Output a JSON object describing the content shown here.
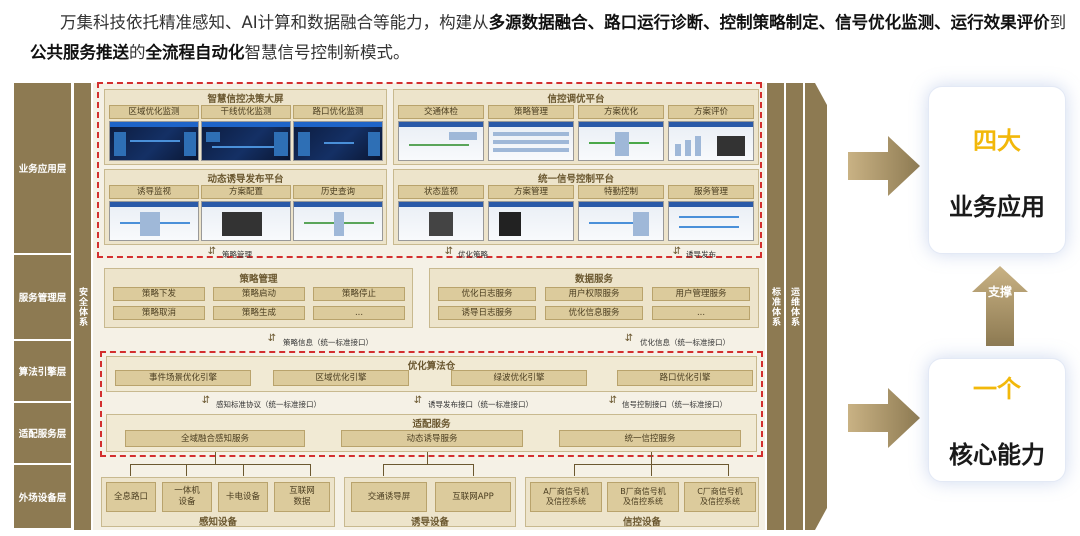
{
  "intro": {
    "p1": "万集科技依托精准感知、AI计算和数据融合等能力，构建从",
    "b1": "多源数据融合、路口运行诊断、控制策略制定、信号优化监测、运行效果评价",
    "p2": "到",
    "b2": "公共服务推送",
    "p3": "的",
    "b3": "全流程自动化",
    "p4": "智慧信号控制新模式。"
  },
  "layers": [
    "业务应用层",
    "服务管理层",
    "算法引擎层",
    "适配服务层",
    "外场设备层"
  ],
  "side_columns": {
    "security": "安全体系",
    "standard": "标准体系",
    "ops": "运维体系"
  },
  "app_panels": {
    "decision": {
      "title": "智慧信控决策大屏",
      "tabs": [
        "区域优化监测",
        "干线优化监测",
        "路口优化监测"
      ]
    },
    "tuning": {
      "title": "信控调优平台",
      "tabs": [
        "交通体检",
        "策略管理",
        "方案优化",
        "方案评价"
      ]
    },
    "guidance": {
      "title": "动态诱导发布平台",
      "tabs": [
        "诱导监视",
        "方案配置",
        "历史查询"
      ]
    },
    "unified": {
      "title": "统一信号控制平台",
      "tabs": [
        "状态监视",
        "方案管理",
        "特勤控制",
        "服务管理"
      ]
    }
  },
  "app_links": [
    "策略管理",
    "优化策略",
    "诱导发布"
  ],
  "service": {
    "strategy": {
      "title": "策略管理",
      "items": [
        "策略下发",
        "策略启动",
        "策略停止",
        "策略取消",
        "策略生成",
        "..."
      ]
    },
    "data": {
      "title": "数据服务",
      "items": [
        "优化日志服务",
        "用户权限服务",
        "用户管理服务",
        "诱导日志服务",
        "优化信息服务",
        "..."
      ]
    }
  },
  "service_links": [
    "策略信息（统一标准接口）",
    "优化信息（统一标准接口）"
  ],
  "algo": {
    "title": "优化算法仓",
    "items": [
      "事件场景优化引擎",
      "区域优化引擎",
      "绿波优化引擎",
      "路口优化引擎"
    ]
  },
  "algo_links": [
    "感知标准协议（统一标准接口）",
    "诱导发布接口（统一标准接口）",
    "信号控制接口（统一标准接口）"
  ],
  "adapter": {
    "title": "适配服务",
    "items": [
      "全域融合感知服务",
      "动态诱导服务",
      "统一信控服务"
    ]
  },
  "devices": {
    "sense": {
      "title": "感知设备",
      "items": [
        "全息路口",
        "一体机\n设备",
        "卡电设备",
        "互联网\n数据"
      ]
    },
    "guide": {
      "title": "诱导设备",
      "items": [
        "交通诱导屏",
        "互联网APP"
      ]
    },
    "signal": {
      "title": "信控设备",
      "items": [
        "A厂商信号机\n及信控系统",
        "B厂商信号机\n及信控系统",
        "C厂商信号机\n及信控系统"
      ]
    }
  },
  "right": {
    "top_yellow": "四大",
    "top_black": "业务应用",
    "support": "支撑",
    "bottom_yellow": "一个",
    "bottom_black": "核心能力"
  },
  "colors": {
    "accent_gold": "#8d7a52",
    "highlight_yellow": "#f2b80a",
    "dashed_red": "#d32f2f"
  }
}
